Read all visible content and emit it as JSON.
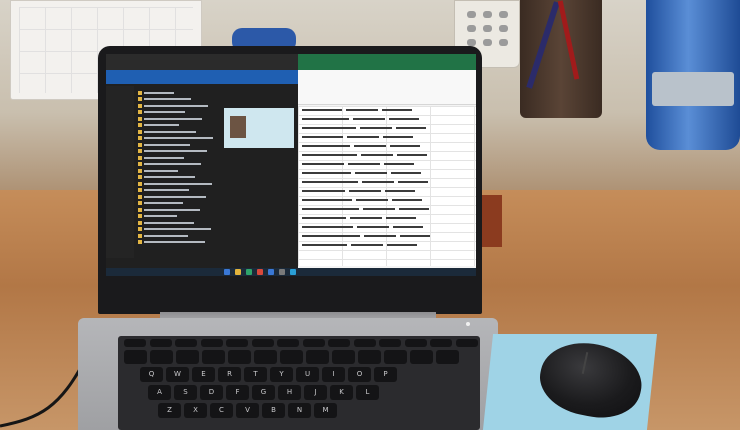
{
  "scene": {
    "description_items": [
      "laptop",
      "mouse",
      "mouse-pad",
      "desk",
      "calendar",
      "remote",
      "pen-cup",
      "jar"
    ]
  },
  "screen": {
    "explorer_title": "",
    "excel_title": ""
  },
  "keyboard": {
    "row1": [
      "Q",
      "W",
      "E",
      "R",
      "T",
      "Y",
      "U",
      "I",
      "O",
      "P"
    ],
    "row2": [
      "A",
      "S",
      "D",
      "F",
      "G",
      "H",
      "J",
      "K",
      "L"
    ],
    "row3": [
      "Z",
      "X",
      "C",
      "V",
      "B",
      "N",
      "M"
    ]
  },
  "colors": {
    "excel_green": "#217346",
    "explorer_dark": "#202020",
    "mousepad": "#9fd3e6",
    "desk": "#b98558"
  }
}
